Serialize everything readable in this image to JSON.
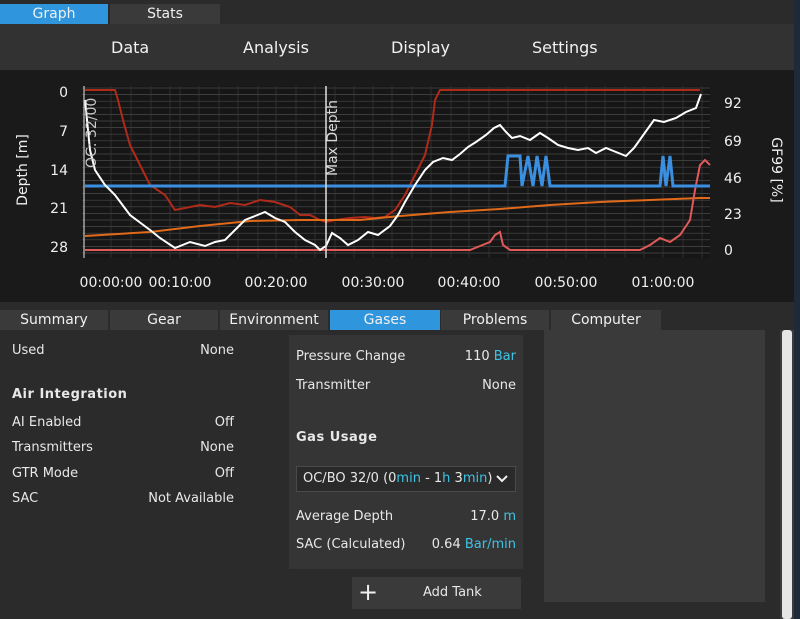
{
  "top_tabs": [
    "Graph",
    "Stats"
  ],
  "menu": [
    "Data",
    "Analysis",
    "Display",
    "Settings"
  ],
  "chart": {
    "ylabel_left": "Depth [m]",
    "ylabel_right": "GF99 [%]",
    "left_ticks": [
      "0",
      "7",
      "14",
      "21",
      "28"
    ],
    "right_ticks": [
      "92",
      "69",
      "46",
      "23",
      "0"
    ],
    "x_ticks": [
      "00:00:00",
      "00:10:00",
      "00:20:00",
      "00:30:00",
      "00:40:00",
      "00:50:00",
      "01:00:00"
    ],
    "gas_annotation": "OC: 32/00",
    "max_depth_annotation": "Max Depth",
    "colors": {
      "depth": "#ffffff",
      "gf": "#3a8fe0",
      "ceiling": "#b22a1a",
      "tissue": "#e06a1a",
      "gf_surface": "#e05a5a"
    }
  },
  "chart_data": {
    "type": "line",
    "xlabel": "",
    "ylabel": "Depth [m]",
    "x_unit": "time",
    "xlim": [
      "00:00:00",
      "01:05:00"
    ],
    "ylim": [
      28,
      0
    ],
    "series": [
      {
        "values_x_min": [
          0,
          3,
          6,
          9,
          12,
          15,
          18,
          21,
          24,
          25.5,
          27,
          30,
          33,
          35,
          37,
          40,
          42,
          45,
          48,
          51,
          54,
          57,
          60,
          62,
          64,
          65
        ],
        "values": [
          0,
          12,
          20,
          27,
          26,
          23,
          21,
          20,
          24,
          28,
          25,
          24,
          20,
          15,
          10,
          8,
          6,
          9,
          10,
          11,
          10,
          11,
          10,
          7,
          5,
          0
        ]
      }
    ]
  },
  "bottom_tabs": [
    "Summary",
    "Gear",
    "Environment",
    "Gases",
    "Problems",
    "Computer"
  ],
  "left": {
    "used_label": "Used",
    "used_value": "None",
    "air_integration_title": "Air Integration",
    "ai_enabled_label": "AI Enabled",
    "ai_enabled_value": "Off",
    "transmitters_label": "Transmitters",
    "transmitters_value": "None",
    "gtr_mode_label": "GTR Mode",
    "gtr_mode_value": "Off",
    "sac_label": "SAC",
    "sac_value": "Not Available"
  },
  "mid": {
    "pressure_change_label": "Pressure Change",
    "pressure_change_value": "110",
    "pressure_change_unit": "Bar",
    "transmitter_label": "Transmitter",
    "transmitter_value": "None",
    "gas_usage_title": "Gas Usage",
    "dropdown_prefix": "OC/BO 32/0 (0",
    "dropdown_u1": "min",
    "dropdown_mid": " - 1",
    "dropdown_u2": "h",
    "dropdown_mid2": " 3",
    "dropdown_u3": "min",
    "dropdown_suffix": ")",
    "avg_depth_label": "Average Depth",
    "avg_depth_value": "17.0",
    "avg_depth_unit": "m",
    "sac_calc_label": "SAC (Calculated)",
    "sac_calc_value": "0.64",
    "sac_calc_unit": "Bar/min"
  },
  "add_tank_label": "Add Tank"
}
